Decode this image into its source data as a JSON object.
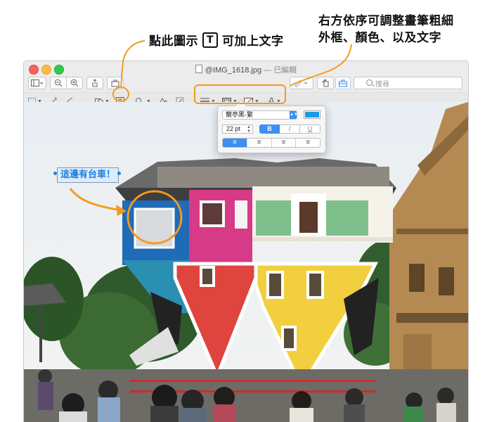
{
  "annotations": {
    "click_hint_before": "點此圖示",
    "click_hint_icon": "T",
    "click_hint_after": "可加上文字",
    "right_hint_line1": "右方依序可調整畫筆粗細",
    "right_hint_line2": "外框、顏色、以及文字"
  },
  "window": {
    "filename": "@IMG_1618.jpg",
    "title_separator": "—",
    "title_status": "已編輯",
    "search_placeholder": "搜尋"
  },
  "text_popover": {
    "font_name": "蘭亭黑-繁",
    "font_size": "22 pt",
    "bold_label": "B",
    "italic_label": "I",
    "underline_label": "U",
    "text_color": "#1a9be6",
    "align_left": "≡",
    "align_center": "≡",
    "align_right": "≡",
    "align_justify": "≡"
  },
  "photo_textbox": {
    "text": "這邊有台車！"
  },
  "colors": {
    "annotation_orange": "#f39a1e",
    "accent_blue": "#3e8ef3"
  }
}
